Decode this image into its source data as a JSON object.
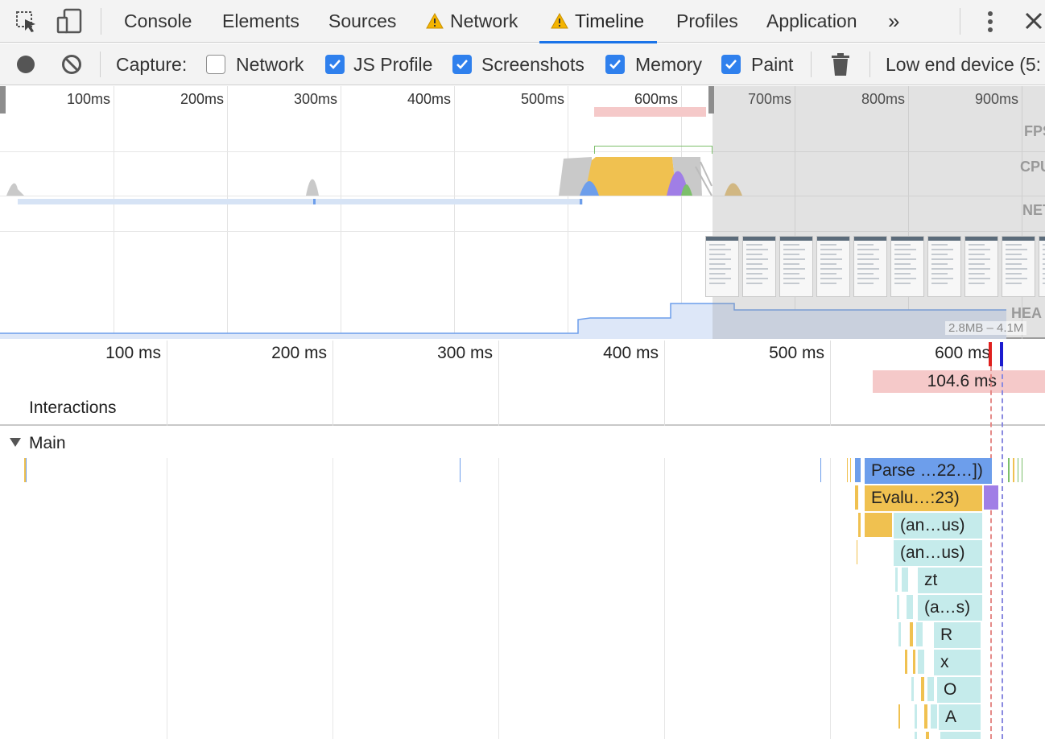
{
  "tabs": {
    "console": "Console",
    "elements": "Elements",
    "sources": "Sources",
    "network": "Network",
    "timeline": "Timeline",
    "profiles": "Profiles",
    "application": "Application",
    "more": "»"
  },
  "toolbar": {
    "capture_label": "Capture:",
    "network": {
      "label": "Network",
      "checked": false
    },
    "js_profile": {
      "label": "JS Profile",
      "checked": true
    },
    "screenshots": {
      "label": "Screenshots",
      "checked": true
    },
    "memory": {
      "label": "Memory",
      "checked": true
    },
    "paint": {
      "label": "Paint",
      "checked": true
    },
    "throttle": "Low end device (5:"
  },
  "overview": {
    "ticks": [
      "100ms",
      "200ms",
      "300ms",
      "400ms",
      "500ms",
      "600ms",
      "700ms",
      "800ms",
      "900ms"
    ],
    "tracks": {
      "fps": "FPS",
      "cpu": "CPU",
      "net": "NET",
      "heap": "HEA"
    },
    "heap_range": "2.8MB – 4.1M"
  },
  "ruler": {
    "ticks": [
      "100 ms",
      "200 ms",
      "300 ms",
      "400 ms",
      "500 ms",
      "600 ms"
    ],
    "interaction_duration": "104.6 ms",
    "interactions_label": "Interactions"
  },
  "main": {
    "label": "Main",
    "blocks": [
      "Parse …22…])",
      "Evalu…:23)",
      "(an…us)",
      "(an…us)",
      "zt",
      "(a…s)",
      "R",
      "x",
      "O",
      "A"
    ]
  },
  "colors": {
    "accent": "#1a73e8",
    "checkbox": "#2f80ed",
    "scripting": "#f0c150",
    "loading": "#6d9eeb",
    "rendering": "#a07ee6",
    "painting": "#7cbf6a",
    "js_frame": "#c5ebeb",
    "interaction": "#f5c9c9"
  }
}
